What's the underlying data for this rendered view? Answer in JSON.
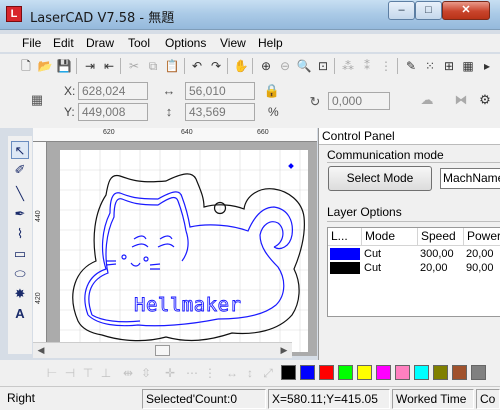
{
  "window": {
    "title": "LaserCAD V7.58 - 無題",
    "app_icon_glyph": "L",
    "minimize_glyph": "–",
    "maximize_glyph": "□",
    "close_glyph": "✕"
  },
  "menu": [
    {
      "label": "File"
    },
    {
      "label": "Edit"
    },
    {
      "label": "Draw"
    },
    {
      "label": "Tool"
    },
    {
      "label": "Options"
    },
    {
      "label": "View"
    },
    {
      "label": "Help"
    }
  ],
  "coords": {
    "x_label": "X:",
    "x_value": "628,024",
    "y_label": "Y:",
    "y_value": "449,008",
    "width_value": "56,010",
    "height_value": "43,569",
    "rotate_value": "0,000",
    "percent_label": "%"
  },
  "rulers": {
    "top": [
      "620",
      "640",
      "660"
    ],
    "left": [
      "440",
      "420"
    ]
  },
  "drawing": {
    "text": "Hellmaker",
    "outline_color": "#1a1aff",
    "cut_color": "#000000"
  },
  "control_panel": {
    "header": "Control Panel",
    "comm_label": "Communication mode",
    "select_mode_label": "Select Mode",
    "machine_field": "MachName",
    "layer_label": "Layer Options",
    "columns": [
      "L...",
      "Mode",
      "Speed",
      "Power"
    ],
    "layers": [
      {
        "color": "#0000ff",
        "mode": "Cut",
        "speed": "300,00",
        "power": "20,00"
      },
      {
        "color": "#000000",
        "mode": "Cut",
        "speed": "20,00",
        "power": "90,00"
      }
    ]
  },
  "palette": [
    "#000000",
    "#0000ff",
    "#ff0000",
    "#00ff00",
    "#ffff00",
    "#ff00ff",
    "#ff80c0",
    "#00ffff",
    "#808000",
    "#a0522d",
    "#808080",
    "#ff8040"
  ],
  "status": {
    "mode": "Right",
    "selected": "Selected'Count:0",
    "position": "X=580.11;Y=415.05",
    "worked_time": "Worked Time",
    "extra": "Co"
  }
}
